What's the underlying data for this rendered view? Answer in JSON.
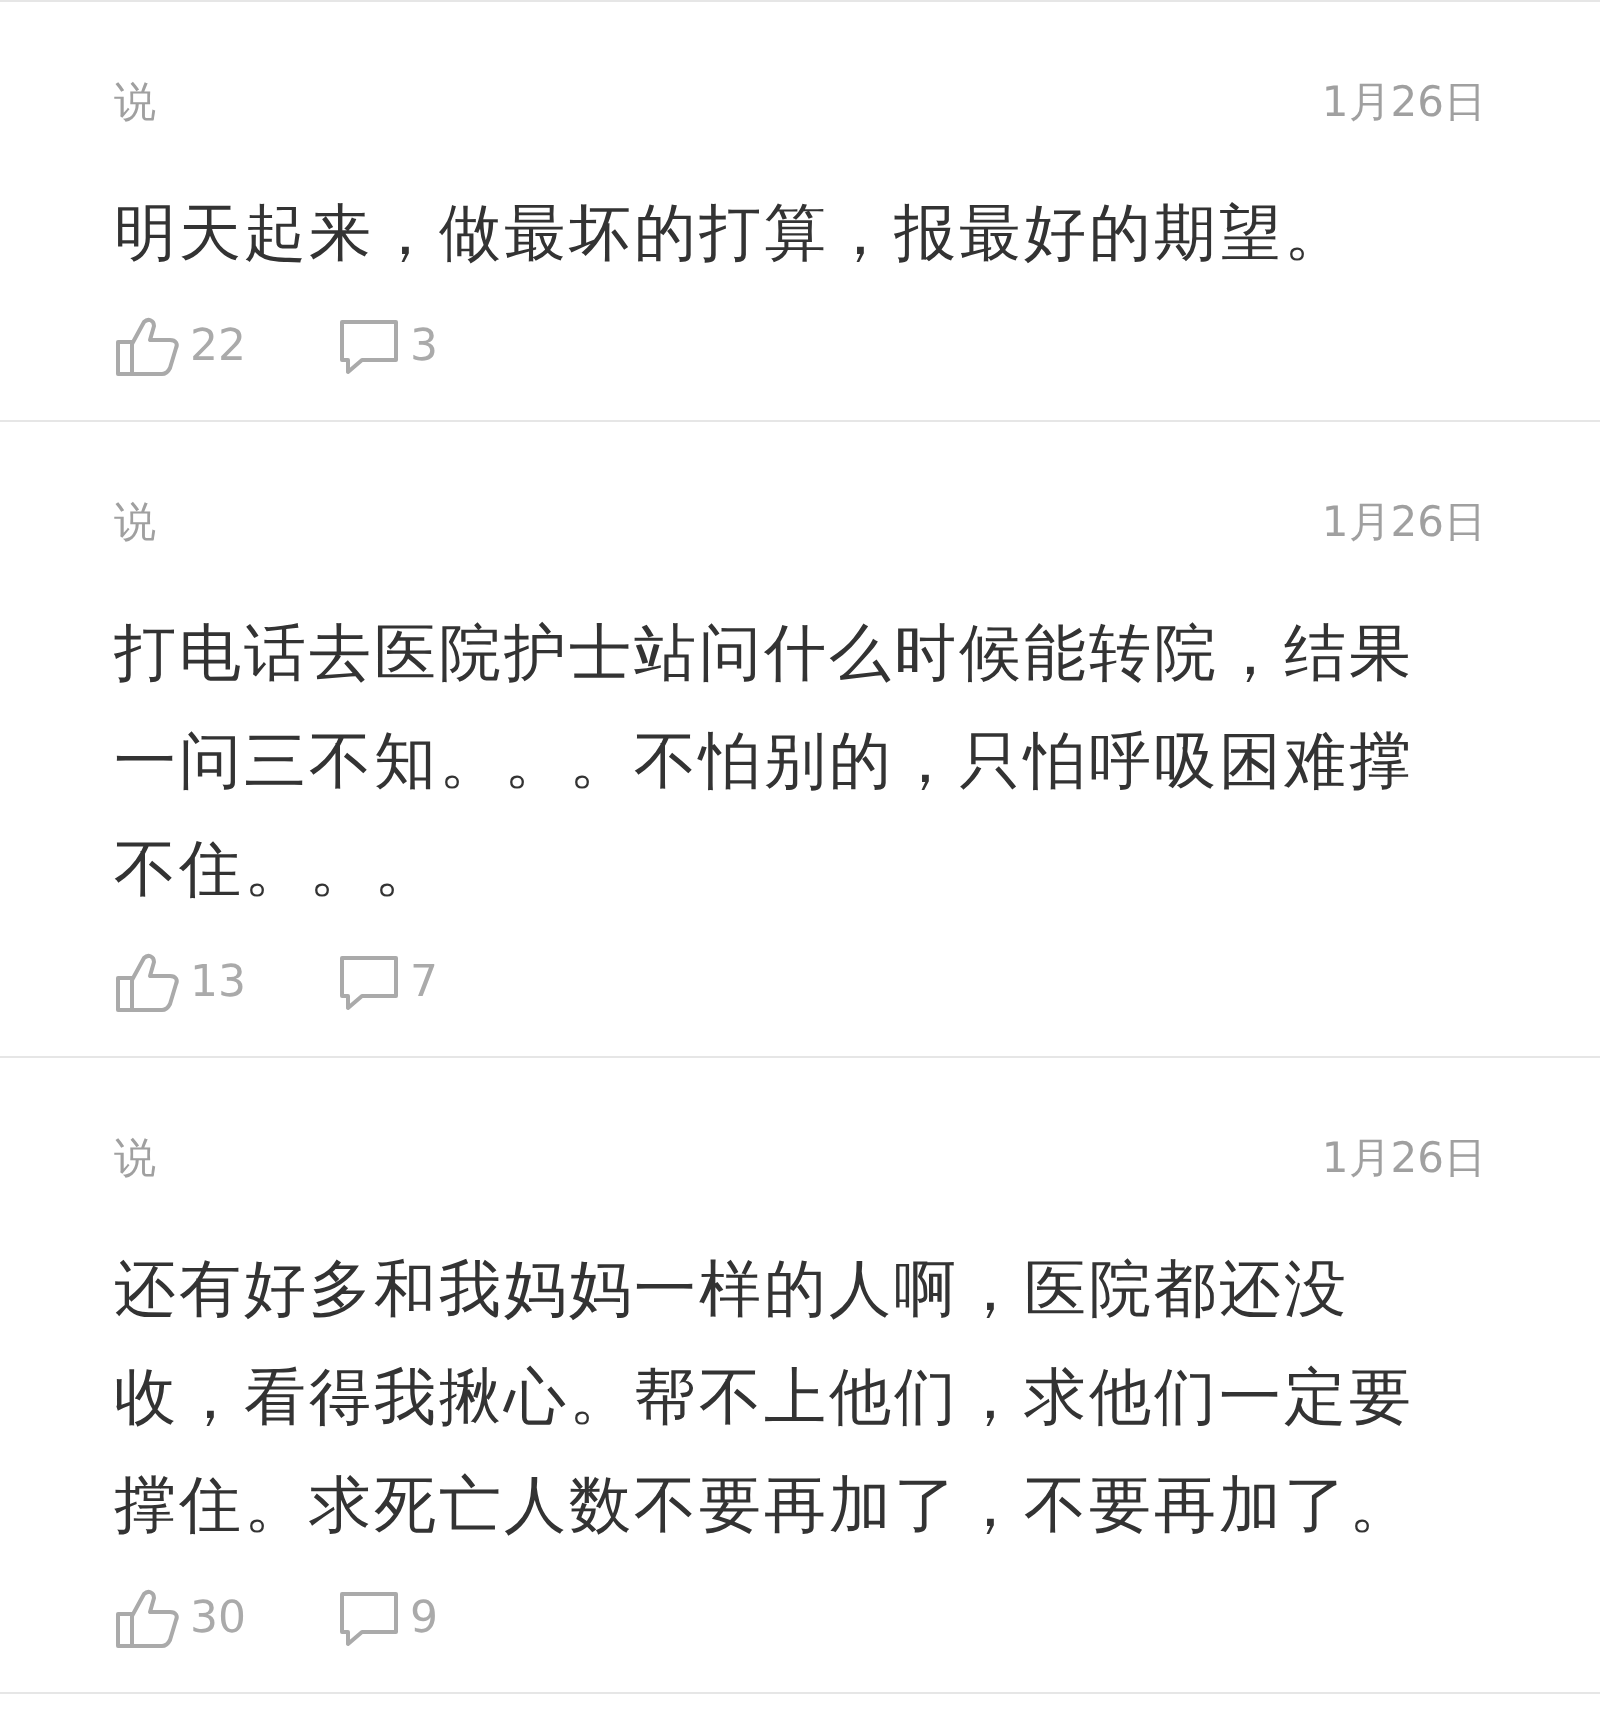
{
  "comments": [
    {
      "author": "说",
      "date": "1月26日",
      "text": "明天起来，做最坏的打算，报最好的期望。",
      "likes": "22",
      "replies": "3"
    },
    {
      "author": "说",
      "date": "1月26日",
      "text": "打电话去医院护士站问什么时候能转院，结果一问三不知。。。不怕别的，只怕呼吸困难撑不住。。。",
      "likes": "13",
      "replies": "7"
    },
    {
      "author": "说",
      "date": "1月26日",
      "text": "还有好多和我妈妈一样的人啊，医院都还没收，看得我揪心。帮不上他们，求他们一定要撑住。求死亡人数不要再加了，不要再加了。",
      "likes": "30",
      "replies": "9"
    }
  ]
}
